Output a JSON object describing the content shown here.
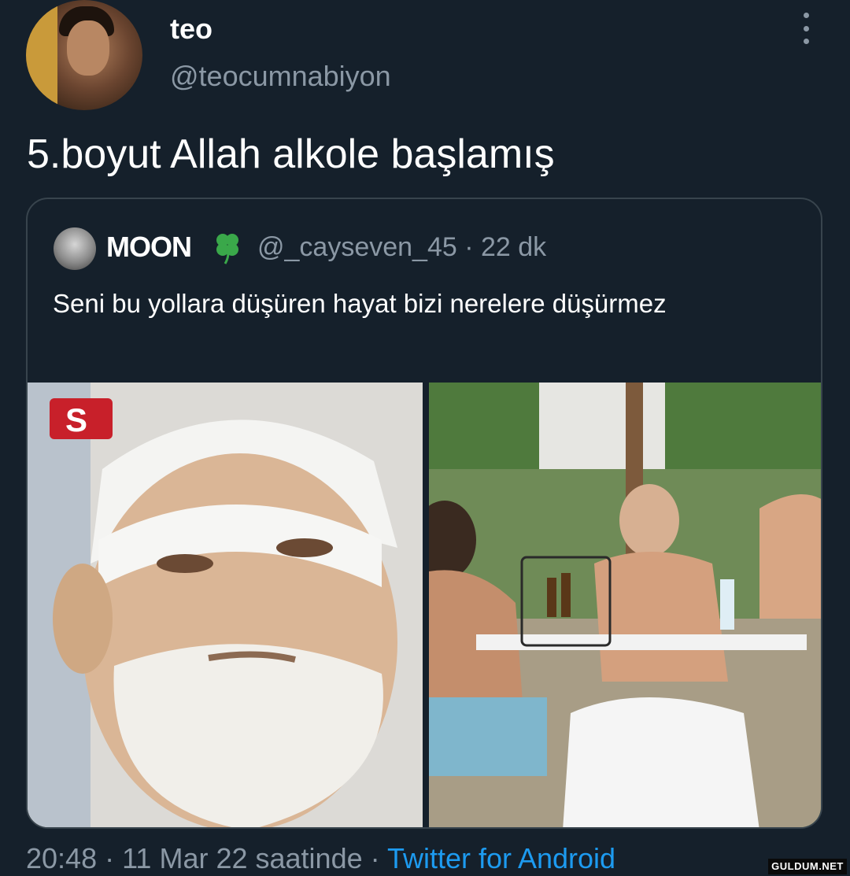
{
  "tweet": {
    "author": {
      "name": "teo",
      "handle": "@teocumnabiyon"
    },
    "text": "5.boyut Allah alkole başlamış",
    "timestamp": "20:48 · 11 Mar 22 saatinde · ",
    "source": "Twitter for Android"
  },
  "quoted_tweet": {
    "author": {
      "name": "MOON",
      "handle_and_time": "@_cayseven_45 · 22 dk"
    },
    "text": "Seni bu yollara düşüren hayat bizi nerelere düşürmez",
    "images": [
      "face-closeup-photo",
      "beach-table-photo"
    ]
  },
  "icons": {
    "more": "more-vertical-icon",
    "clover": "four-leaf-clover-icon"
  },
  "watermark": "GULDUM.NET",
  "colors": {
    "background": "#15202b",
    "secondary_text": "#8b98a5",
    "link": "#1d9bf0",
    "border": "#38444d"
  }
}
